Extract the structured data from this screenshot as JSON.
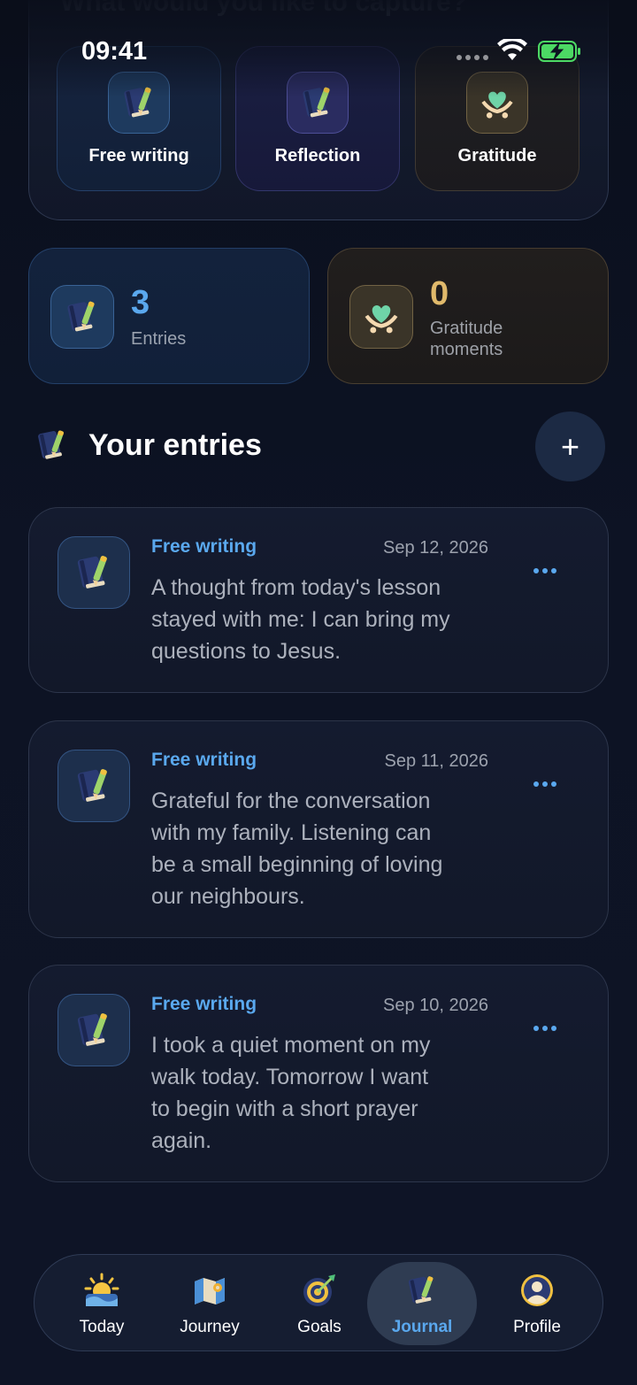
{
  "status": {
    "time": "09:41"
  },
  "capture": {
    "title": "What would you like to capture?",
    "types": [
      {
        "label": "Free writing",
        "icon": "journal-pencil-icon"
      },
      {
        "label": "Reflection",
        "icon": "journal-pencil-icon"
      },
      {
        "label": "Gratitude",
        "icon": "heart-hands-icon"
      }
    ]
  },
  "stats": {
    "entries": {
      "value": "3",
      "label": "Entries"
    },
    "gratitude": {
      "value": "0",
      "label_line1": "Gratitude",
      "label_line2": "moments"
    }
  },
  "section": {
    "title": "Your entries"
  },
  "entries": [
    {
      "type": "Free writing",
      "date": "Sep 12, 2026",
      "lines": [
        "A thought from today's lesson",
        "stayed with me: I can bring my",
        "questions to Jesus."
      ]
    },
    {
      "type": "Free writing",
      "date": "Sep 11, 2026",
      "lines": [
        "Grateful for the conversation",
        "with my family. Listening can",
        "be a small beginning of loving",
        "our neighbours."
      ]
    },
    {
      "type": "Free writing",
      "date": "Sep 10, 2026",
      "lines": [
        "I took a quiet moment on my",
        "walk today. Tomorrow I want",
        "to begin with a short prayer",
        "again."
      ]
    }
  ],
  "nav": {
    "tabs": [
      {
        "label": "Today",
        "icon": "sunrise-icon"
      },
      {
        "label": "Journey",
        "icon": "map-icon"
      },
      {
        "label": "Goals",
        "icon": "target-icon"
      },
      {
        "label": "Journal",
        "icon": "journal-pencil-icon"
      },
      {
        "label": "Profile",
        "icon": "profile-icon"
      }
    ],
    "active": "Journal"
  },
  "colors": {
    "accent": "#5aa8ee",
    "gold": "#e0b96b",
    "background": "#0c1120"
  }
}
